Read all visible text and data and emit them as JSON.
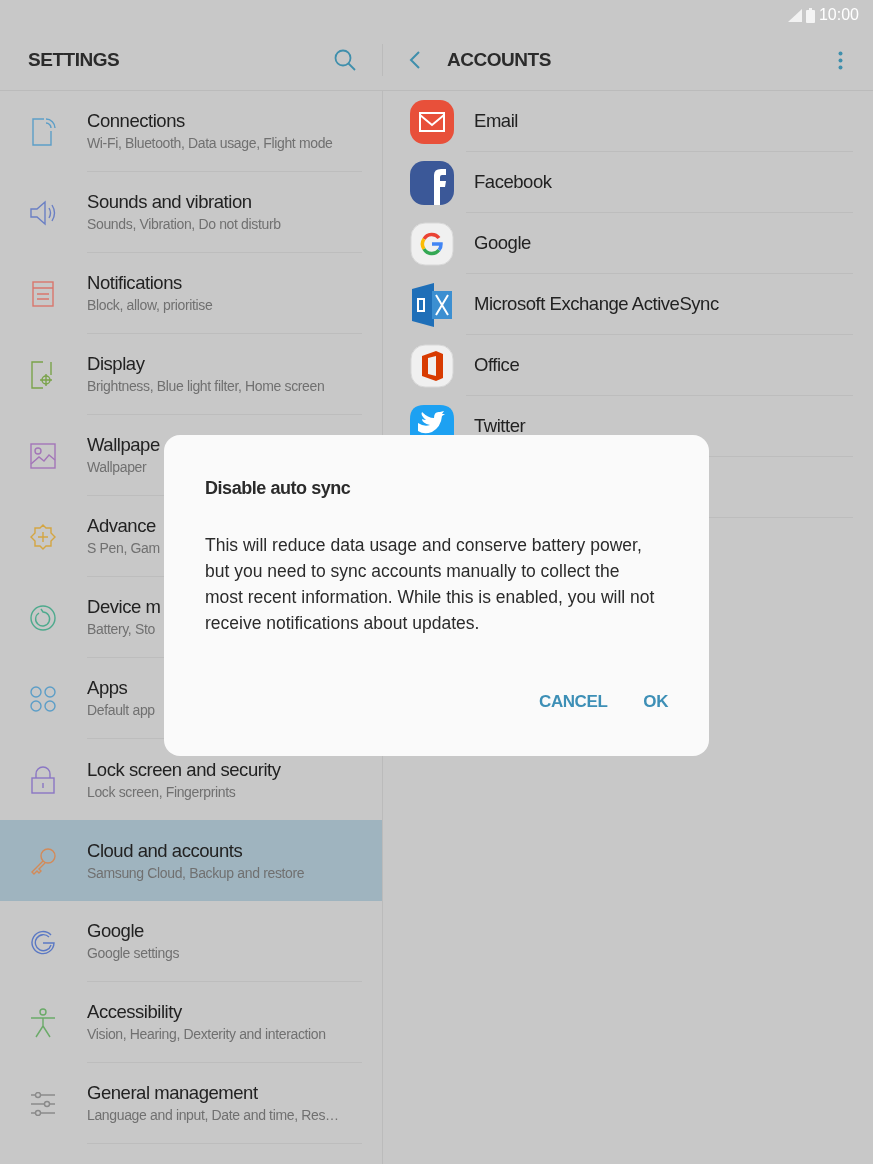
{
  "status_bar": {
    "time": "10:00"
  },
  "settings_header": {
    "title": "SETTINGS"
  },
  "settings_items": [
    {
      "title": "Connections",
      "subtitle": "Wi-Fi, Bluetooth, Data usage, Flight mode",
      "selected": false
    },
    {
      "title": "Sounds and vibration",
      "subtitle": "Sounds, Vibration, Do not disturb",
      "selected": false
    },
    {
      "title": "Notifications",
      "subtitle": "Block, allow, prioritise",
      "selected": false
    },
    {
      "title": "Display",
      "subtitle": "Brightness, Blue light filter, Home screen",
      "selected": false
    },
    {
      "title": "Wallpape",
      "subtitle": "Wallpaper",
      "selected": false
    },
    {
      "title": "Advance",
      "subtitle": "S Pen, Gam",
      "selected": false
    },
    {
      "title": "Device m",
      "subtitle": "Battery, Sto",
      "selected": false
    },
    {
      "title": "Apps",
      "subtitle": "Default app",
      "selected": false
    },
    {
      "title": "Lock screen and security",
      "subtitle": "Lock screen, Fingerprints",
      "selected": false
    },
    {
      "title": "Cloud and accounts",
      "subtitle": "Samsung Cloud, Backup and restore",
      "selected": true
    },
    {
      "title": "Google",
      "subtitle": "Google settings",
      "selected": false
    },
    {
      "title": "Accessibility",
      "subtitle": "Vision, Hearing, Dexterity and interaction",
      "selected": false
    },
    {
      "title": "General management",
      "subtitle": "Language and input, Date and time, Res…",
      "selected": false
    }
  ],
  "accounts_header": {
    "title": "ACCOUNTS"
  },
  "accounts": [
    {
      "name": "Email"
    },
    {
      "name": "Facebook"
    },
    {
      "name": "Google"
    },
    {
      "name": "Microsoft Exchange ActiveSync"
    },
    {
      "name": "Office"
    },
    {
      "name": "Twitter"
    }
  ],
  "dialog": {
    "title": "Disable auto sync",
    "message": "This will reduce data usage and conserve battery power, but you need to sync accounts manually to collect the most recent information. While this is enabled, you will not receive notifications about updates.",
    "buttons": [
      "CANCEL",
      "OK"
    ]
  }
}
